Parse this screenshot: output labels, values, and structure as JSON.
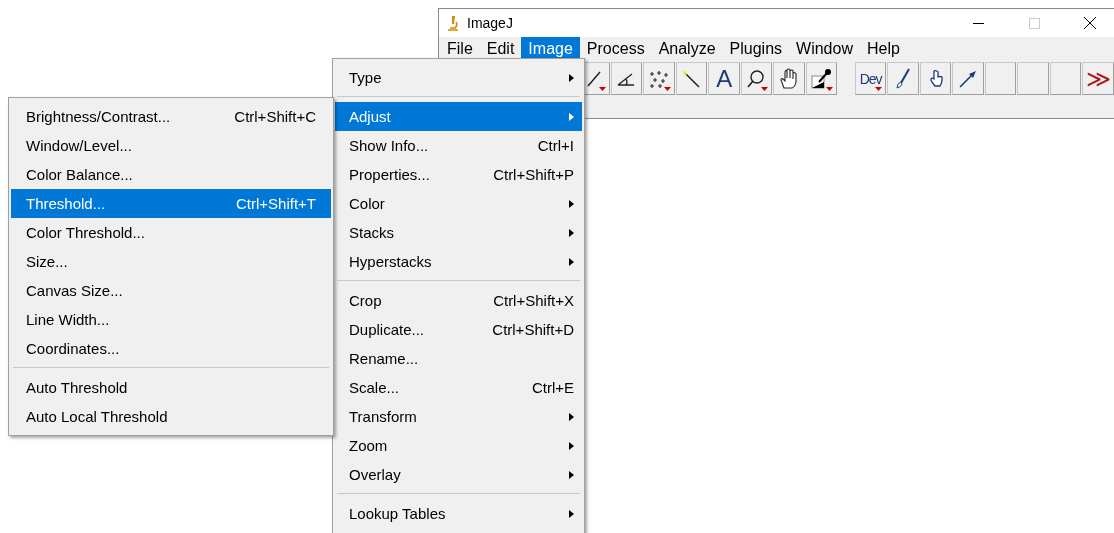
{
  "window": {
    "title": "ImageJ"
  },
  "menubar": [
    {
      "label": "File",
      "selected": false
    },
    {
      "label": "Edit",
      "selected": false
    },
    {
      "label": "Image",
      "selected": true
    },
    {
      "label": "Process",
      "selected": false
    },
    {
      "label": "Analyze",
      "selected": false
    },
    {
      "label": "Plugins",
      "selected": false
    },
    {
      "label": "Window",
      "selected": false
    },
    {
      "label": "Help",
      "selected": false
    }
  ],
  "toolbar": [
    {
      "kind": "line",
      "has_menu": true
    },
    {
      "kind": "angle",
      "has_menu": false
    },
    {
      "kind": "multipoint",
      "has_menu": true
    },
    {
      "kind": "wand",
      "has_menu": false
    },
    {
      "kind": "text",
      "label": "A",
      "has_menu": false
    },
    {
      "kind": "zoom",
      "has_menu": true
    },
    {
      "kind": "hand",
      "has_menu": false
    },
    {
      "kind": "picker",
      "has_menu": true
    },
    {
      "kind": "gap"
    },
    {
      "kind": "text",
      "label": "Dev",
      "has_menu": true
    },
    {
      "kind": "brush",
      "has_menu": false
    },
    {
      "kind": "finger",
      "has_menu": false
    },
    {
      "kind": "arrow",
      "has_menu": false
    },
    {
      "kind": "empty",
      "has_menu": false
    },
    {
      "kind": "empty",
      "has_menu": false
    },
    {
      "kind": "empty",
      "has_menu": false
    },
    {
      "kind": "more",
      "label": "≫",
      "has_menu": false
    }
  ],
  "image_menu": [
    {
      "kind": "submenu",
      "label": "Type",
      "selected": false
    },
    {
      "kind": "separator"
    },
    {
      "kind": "submenu",
      "label": "Adjust",
      "selected": true
    },
    {
      "kind": "item",
      "label": "Show Info...",
      "shortcut": "Ctrl+I",
      "selected": false
    },
    {
      "kind": "item",
      "label": "Properties...",
      "shortcut": "Ctrl+Shift+P",
      "selected": false
    },
    {
      "kind": "submenu",
      "label": "Color",
      "selected": false
    },
    {
      "kind": "submenu",
      "label": "Stacks",
      "selected": false
    },
    {
      "kind": "submenu",
      "label": "Hyperstacks",
      "selected": false
    },
    {
      "kind": "separator"
    },
    {
      "kind": "item",
      "label": "Crop",
      "shortcut": "Ctrl+Shift+X",
      "selected": false
    },
    {
      "kind": "item",
      "label": "Duplicate...",
      "shortcut": "Ctrl+Shift+D",
      "selected": false
    },
    {
      "kind": "item",
      "label": "Rename...",
      "selected": false
    },
    {
      "kind": "item",
      "label": "Scale...",
      "shortcut": "Ctrl+E",
      "selected": false
    },
    {
      "kind": "submenu",
      "label": "Transform",
      "selected": false
    },
    {
      "kind": "submenu",
      "label": "Zoom",
      "selected": false
    },
    {
      "kind": "submenu",
      "label": "Overlay",
      "selected": false
    },
    {
      "kind": "separator"
    },
    {
      "kind": "submenu",
      "label": "Lookup Tables",
      "selected": false
    }
  ],
  "adjust_menu": [
    {
      "kind": "item",
      "label": "Brightness/Contrast...",
      "shortcut": "Ctrl+Shift+C",
      "selected": false
    },
    {
      "kind": "item",
      "label": "Window/Level...",
      "selected": false
    },
    {
      "kind": "item",
      "label": "Color Balance...",
      "selected": false
    },
    {
      "kind": "item",
      "label": "Threshold...",
      "shortcut": "Ctrl+Shift+T",
      "selected": true
    },
    {
      "kind": "item",
      "label": "Color Threshold...",
      "selected": false
    },
    {
      "kind": "item",
      "label": "Size...",
      "selected": false
    },
    {
      "kind": "item",
      "label": "Canvas Size...",
      "selected": false
    },
    {
      "kind": "item",
      "label": "Line Width...",
      "selected": false
    },
    {
      "kind": "item",
      "label": "Coordinates...",
      "selected": false
    },
    {
      "kind": "separator"
    },
    {
      "kind": "item",
      "label": "Auto Threshold",
      "selected": false
    },
    {
      "kind": "item",
      "label": "Auto Local Threshold",
      "selected": false
    }
  ]
}
